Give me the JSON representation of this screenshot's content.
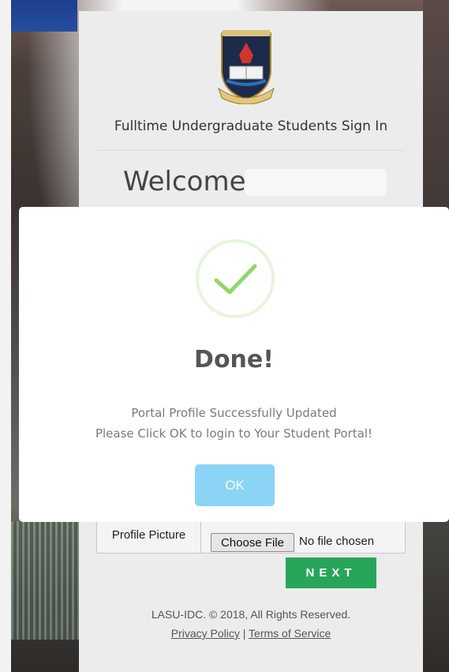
{
  "card": {
    "title": "Fulltime Undergraduate Students Sign In",
    "welcome": "Welcome!",
    "crest_icon": "university-crest-icon"
  },
  "profile_upload": {
    "label": "Profile Picture",
    "button_label": "Choose File",
    "status": "No file chosen"
  },
  "next_button": {
    "label": "NEXT"
  },
  "footer": {
    "copyright": "LASU-IDC. © 2018, All Rights Reserved.",
    "privacy": "Privacy Policy",
    "separator": "|",
    "terms": "Terms of Service"
  },
  "dialog": {
    "icon": "checkmark-icon",
    "title": "Done!",
    "message_line1": "Portal Profile Successfully Updated",
    "message_line2": "Please Click OK to login to Your Student Portal!",
    "ok_label": "OK"
  },
  "colors": {
    "next_button": "#27a65a",
    "ok_button": "#8cd4f5",
    "check": "#8fd86a"
  }
}
